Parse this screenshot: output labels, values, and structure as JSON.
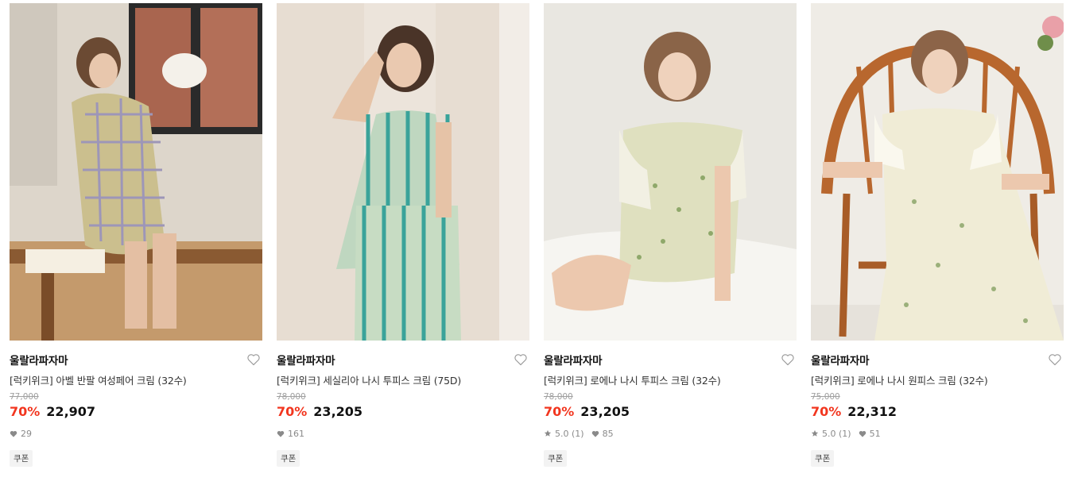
{
  "products": [
    {
      "brand": "울랄라파자마",
      "title": "[럭키위크] 아벨 반팔 여성페어 크림 (32수)",
      "original_price": "77,000",
      "discount": "70%",
      "price": "22,907",
      "rating": "",
      "likes": "29",
      "coupon": "쿠폰",
      "image_icon": "product-photo-plaid-short-pajama"
    },
    {
      "brand": "울랄라파자마",
      "title": "[럭키위크] 세실리아 나시 투피스 크림 (75D)",
      "original_price": "78,000",
      "discount": "70%",
      "price": "23,205",
      "rating": "",
      "likes": "161",
      "coupon": "쿠폰",
      "image_icon": "product-photo-striped-camisole-set"
    },
    {
      "brand": "울랄라파자마",
      "title": "[럭키위크] 로에나 나시 투피스 크림 (32수)",
      "original_price": "78,000",
      "discount": "70%",
      "price": "23,205",
      "rating": "5.0 (1)",
      "likes": "85",
      "coupon": "쿠폰",
      "image_icon": "product-photo-floral-short-set"
    },
    {
      "brand": "울랄라파자마",
      "title": "[럭키위크] 로에나 나시 원피스 크림 (32수)",
      "original_price": "75,000",
      "discount": "70%",
      "price": "22,312",
      "rating": "5.0 (1)",
      "likes": "51",
      "coupon": "쿠폰",
      "image_icon": "product-photo-floral-long-dress"
    }
  ],
  "colors": {
    "discount": "#f2361f",
    "text": "#111111",
    "muted": "#8a8a8a",
    "strike": "#a0a0a0"
  }
}
